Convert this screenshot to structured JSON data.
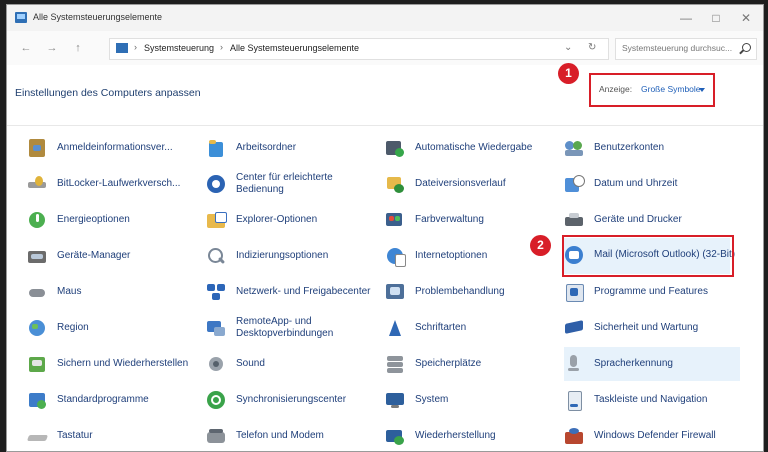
{
  "window": {
    "title": "Alle Systemsteuerungselemente"
  },
  "window_controls": {
    "minimize": "—",
    "maximize": "□",
    "close": "✕"
  },
  "nav": {
    "back": "←",
    "forward": "→",
    "up": "↑"
  },
  "breadcrumb": {
    "items": [
      "Systemsteuerung",
      "Alle Systemsteuerungselemente"
    ],
    "separator": "›",
    "dropdown": "⌄",
    "refresh": "↻"
  },
  "search": {
    "placeholder": "Systemsteuerung durchsuc..."
  },
  "header": {
    "title": "Einstellungen des Computers anpassen"
  },
  "view": {
    "label": "Anzeige:",
    "value": "Große Symbole"
  },
  "annotations": {
    "marker1": "1",
    "marker2": "2"
  },
  "items": {
    "col1": [
      {
        "label": "Anmeldeinformationsver...",
        "icon": "credential-icon"
      },
      {
        "label": "BitLocker-Laufwerkversch...",
        "icon": "bitlocker-icon"
      },
      {
        "label": "Energieoptionen",
        "icon": "power-icon"
      },
      {
        "label": "Geräte-Manager",
        "icon": "device-manager-icon"
      },
      {
        "label": "Maus",
        "icon": "mouse-icon"
      },
      {
        "label": "Region",
        "icon": "region-icon"
      },
      {
        "label": "Sichern und Wiederherstellen",
        "icon": "backup-icon"
      },
      {
        "label": "Standardprogramme",
        "icon": "default-programs-icon"
      },
      {
        "label": "Tastatur",
        "icon": "keyboard-icon"
      }
    ],
    "col2": [
      {
        "label": "Arbeitsordner",
        "icon": "work-folders-icon"
      },
      {
        "label": "Center für erleichterte Bedienung",
        "icon": "ease-of-access-icon"
      },
      {
        "label": "Explorer-Optionen",
        "icon": "explorer-options-icon"
      },
      {
        "label": "Indizierungsoptionen",
        "icon": "indexing-icon"
      },
      {
        "label": "Netzwerk- und Freigabecenter",
        "icon": "network-icon"
      },
      {
        "label": "RemoteApp- und Desktopverbindungen",
        "icon": "remoteapp-icon"
      },
      {
        "label": "Sound",
        "icon": "sound-icon"
      },
      {
        "label": "Synchronisierungscenter",
        "icon": "sync-icon"
      },
      {
        "label": "Telefon und Modem",
        "icon": "phone-icon"
      }
    ],
    "col3": [
      {
        "label": "Automatische Wiedergabe",
        "icon": "autoplay-icon"
      },
      {
        "label": "Dateiversionsverlauf",
        "icon": "file-history-icon"
      },
      {
        "label": "Farbverwaltung",
        "icon": "color-management-icon"
      },
      {
        "label": "Internetoptionen",
        "icon": "internet-options-icon"
      },
      {
        "label": "Problembehandlung",
        "icon": "troubleshooting-icon"
      },
      {
        "label": "Schriftarten",
        "icon": "fonts-icon"
      },
      {
        "label": "Speicherplätze",
        "icon": "storage-spaces-icon"
      },
      {
        "label": "System",
        "icon": "system-icon"
      },
      {
        "label": "Wiederherstellung",
        "icon": "recovery-icon"
      }
    ],
    "col4": [
      {
        "label": "Benutzerkonten",
        "icon": "user-accounts-icon"
      },
      {
        "label": "Datum und Uhrzeit",
        "icon": "date-time-icon"
      },
      {
        "label": "Geräte und Drucker",
        "icon": "devices-printers-icon"
      },
      {
        "label": "Mail (Microsoft Outlook) (32-Bit)",
        "icon": "mail-icon"
      },
      {
        "label": "Programme und Features",
        "icon": "programs-features-icon"
      },
      {
        "label": "Sicherheit und Wartung",
        "icon": "security-maintenance-icon"
      },
      {
        "label": "Spracherkennung",
        "icon": "speech-recognition-icon"
      },
      {
        "label": "Taskleiste und Navigation",
        "icon": "taskbar-icon"
      },
      {
        "label": "Windows Defender Firewall",
        "icon": "firewall-icon"
      }
    ]
  },
  "colors": {
    "accent_red": "#d81e28",
    "link_blue": "#1f3f7a",
    "hover": "#e7f2fb"
  }
}
